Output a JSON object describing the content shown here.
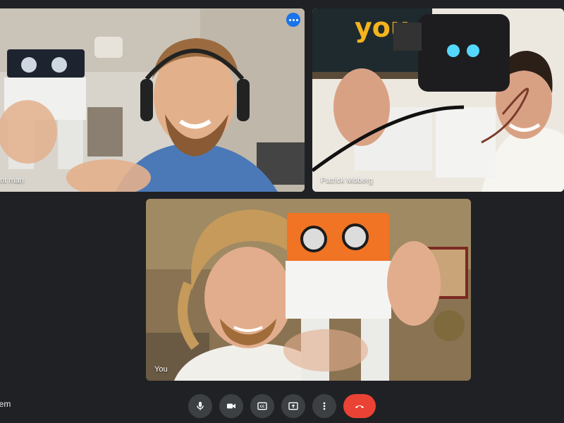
{
  "participants": [
    {
      "name": "ent man",
      "speaking": true
    },
    {
      "name": "Patrick Moberg",
      "speaking": false
    },
    {
      "name": "You",
      "speaking": false
    }
  ],
  "meeting_code": "oem",
  "controls": {
    "mic": "microphone-icon",
    "camera": "camera-icon",
    "captions": "closed-captions-icon",
    "present": "present-screen-icon",
    "more": "more-options-icon",
    "hangup": "hang-up-icon"
  },
  "colors": {
    "background": "#202124",
    "control_bg": "#3c4043",
    "hangup": "#ea4335",
    "active_border": "#8ab4f8",
    "menu_button": "#1a73e8"
  }
}
